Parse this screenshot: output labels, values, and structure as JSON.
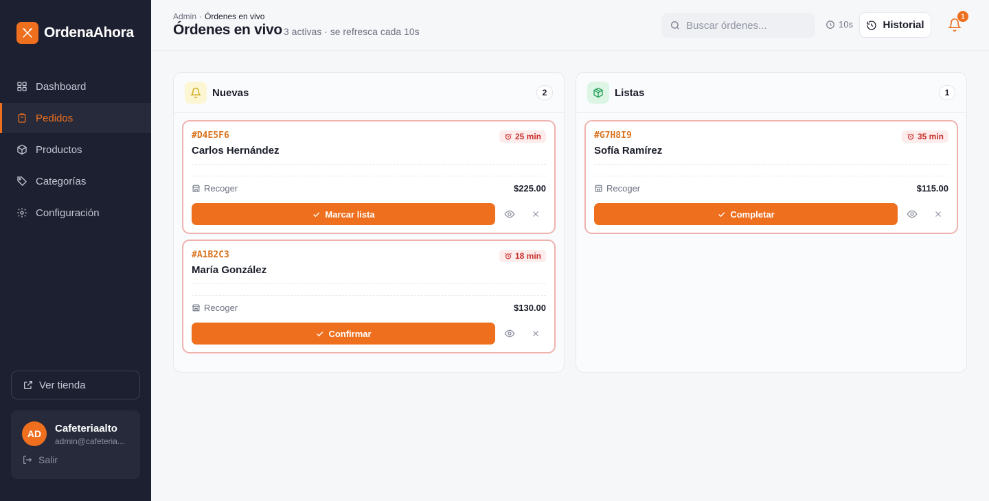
{
  "brand": {
    "name": "OrdenaAhora"
  },
  "sidebar": {
    "items": [
      {
        "label": "Dashboard",
        "icon": "grid-icon"
      },
      {
        "label": "Pedidos",
        "icon": "clipboard-icon",
        "active": true
      },
      {
        "label": "Productos",
        "icon": "box-icon"
      },
      {
        "label": "Categorías",
        "icon": "tag-icon"
      },
      {
        "label": "Configuración",
        "icon": "gear-icon"
      }
    ],
    "store_link": "Ver tienda",
    "user": {
      "initials": "AD",
      "name": "Cafeteriaalto",
      "email": "admin@cafeteria...",
      "logout": "Salir"
    }
  },
  "header": {
    "breadcrumb": {
      "root": "Admin",
      "separator": "·",
      "current": "Órdenes en vivo"
    },
    "title": "Órdenes en vivo",
    "subtitle": "3 activas · se refresca cada 10s",
    "search_placeholder": "Buscar órdenes...",
    "refresh_interval": "10s",
    "history_label": "Historial",
    "notifications_count": "1"
  },
  "colors": {
    "accent": "#ee6f1e",
    "sidebar_bg": "#1d2030",
    "card_border": "#f0b2ae",
    "timer_text": "#c9302c"
  },
  "columns": [
    {
      "title": "Nuevas",
      "count": "2",
      "icon": "bell-icon",
      "orders": [
        {
          "id": "#D4E5F6",
          "customer": "Carlos Hernández",
          "elapsed": "25 min",
          "type": "Recoger",
          "total": "$225.00",
          "action": "Marcar lista"
        },
        {
          "id": "#A1B2C3",
          "customer": "María González",
          "elapsed": "18 min",
          "type": "Recoger",
          "total": "$130.00",
          "action": "Confirmar"
        }
      ]
    },
    {
      "title": "Listas",
      "count": "1",
      "icon": "package-icon",
      "orders": [
        {
          "id": "#G7H8I9",
          "customer": "Sofía Ramírez",
          "elapsed": "35 min",
          "type": "Recoger",
          "total": "$115.00",
          "action": "Completar"
        }
      ]
    }
  ]
}
